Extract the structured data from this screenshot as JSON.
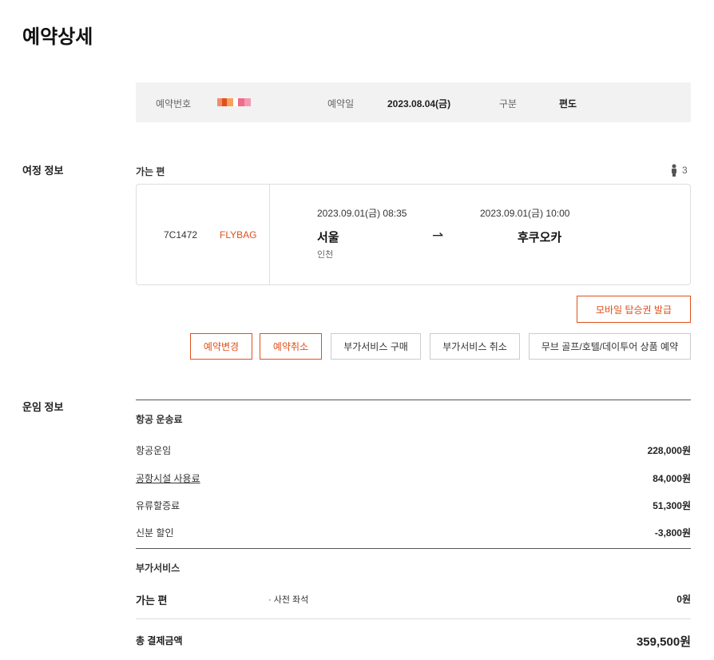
{
  "page": {
    "title": "예약상세"
  },
  "summary": {
    "reservation_number_label": "예약번호",
    "reservation_date_label": "예약일",
    "reservation_date": "2023.08.04(금)",
    "type_label": "구분",
    "type_value": "편도"
  },
  "itinerary": {
    "section_label": "여정 정보",
    "direction_label": "가는 편",
    "passenger_count": "3",
    "flight_number": "7C1472",
    "fare_class": "FLYBAG",
    "departure_datetime": "2023.09.01(금) 08:35",
    "arrival_datetime": "2023.09.01(금) 10:00",
    "departure_city": "서울",
    "departure_airport": "인천",
    "arrival_city": "후쿠오카",
    "arrow": "⇀"
  },
  "actions": {
    "mobile_boarding_pass": "모바일 탑승권 발급",
    "change_reservation": "예약변경",
    "cancel_reservation": "예약취소",
    "buy_addon": "부가서비스 구매",
    "cancel_addon": "부가서비스 취소",
    "golf_hotel_tour": "무브 골프/호텔/데이투어 상품 예약"
  },
  "fare": {
    "section_label": "운임 정보",
    "airfare_header": "항공 운송료",
    "rows": [
      {
        "label": "항공운임",
        "amount": "228,000원"
      },
      {
        "label": "공항시설 사용료",
        "amount": "84,000원"
      },
      {
        "label": "유류할증료",
        "amount": "51,300원"
      },
      {
        "label": "신분 할인",
        "amount": "-3,800원"
      }
    ],
    "addon_header": "부가서비스",
    "addon_direction": "가는 편",
    "addon_item": "· 사전 좌석",
    "addon_amount": "0원",
    "total_label": "총 결제금액",
    "total_amount": "359,500원"
  },
  "colors": {
    "accent": "#e0501b",
    "summary_bg": "#f2f2f2"
  }
}
